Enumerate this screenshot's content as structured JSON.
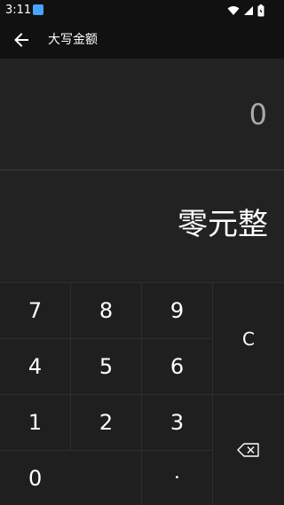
{
  "status_bar": {
    "time": "3:11",
    "app_icon": "keyboard-app-icon",
    "icons": [
      "wifi-icon",
      "signal-icon",
      "battery-icon"
    ]
  },
  "app_bar": {
    "back_icon": "arrow-left-icon",
    "title": "大写金额"
  },
  "display": {
    "number": "0",
    "chinese": "零元整"
  },
  "keypad": {
    "k7": "7",
    "k8": "8",
    "k9": "9",
    "k4": "4",
    "k5": "5",
    "k6": "6",
    "k1": "1",
    "k2": "2",
    "k3": "3",
    "k0": "0",
    "dot": "•",
    "clear": "C",
    "backspace_icon": "backspace-icon"
  },
  "colors": {
    "background": "#1c1c1c",
    "bar": "#111111",
    "display": "#222222",
    "text": "#ffffff",
    "muted_text": "#aaaaaa"
  }
}
